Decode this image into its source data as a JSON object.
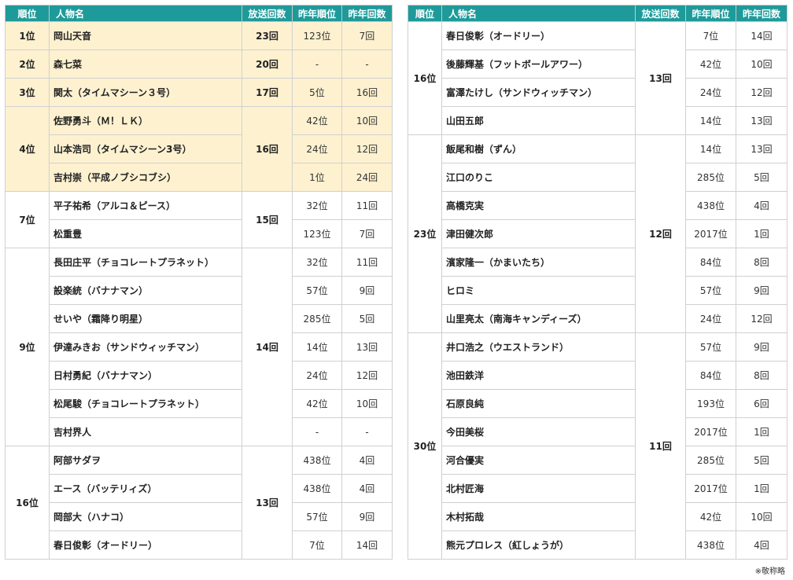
{
  "headers": {
    "rank": "順位",
    "name": "人物名",
    "count": "放送回数",
    "prev_rank": "昨年順位",
    "prev_count": "昨年回数"
  },
  "left_groups": [
    {
      "rank": "1位",
      "count": "23回",
      "highlight": true,
      "people": [
        {
          "name": "岡山天音",
          "prev_rank": "123位",
          "prev_count": "7回"
        }
      ]
    },
    {
      "rank": "2位",
      "count": "20回",
      "highlight": true,
      "people": [
        {
          "name": "森七菜",
          "prev_rank": "-",
          "prev_count": "-"
        }
      ]
    },
    {
      "rank": "3位",
      "count": "17回",
      "highlight": true,
      "people": [
        {
          "name": "関太（タイムマシーン３号）",
          "prev_rank": "5位",
          "prev_count": "16回"
        }
      ]
    },
    {
      "rank": "4位",
      "count": "16回",
      "highlight": true,
      "people": [
        {
          "name": "佐野勇斗（Ｍ！ＬＫ）",
          "prev_rank": "42位",
          "prev_count": "10回"
        },
        {
          "name": "山本浩司（タイムマシーン3号）",
          "prev_rank": "24位",
          "prev_count": "12回"
        },
        {
          "name": "吉村崇（平成ノブシコブシ）",
          "prev_rank": "1位",
          "prev_count": "24回"
        }
      ]
    },
    {
      "rank": "7位",
      "count": "15回",
      "highlight": false,
      "people": [
        {
          "name": "平子祐希（アルコ＆ピース）",
          "prev_rank": "32位",
          "prev_count": "11回"
        },
        {
          "name": "松重豊",
          "prev_rank": "123位",
          "prev_count": "7回"
        }
      ]
    },
    {
      "rank": "9位",
      "count": "14回",
      "highlight": false,
      "people": [
        {
          "name": "長田庄平（チョコレートプラネット）",
          "prev_rank": "32位",
          "prev_count": "11回"
        },
        {
          "name": "設楽統（バナナマン）",
          "prev_rank": "57位",
          "prev_count": "9回"
        },
        {
          "name": "せいや（霜降り明星）",
          "prev_rank": "285位",
          "prev_count": "5回"
        },
        {
          "name": "伊達みきお（サンドウィッチマン）",
          "prev_rank": "14位",
          "prev_count": "13回"
        },
        {
          "name": "日村勇紀（バナナマン）",
          "prev_rank": "24位",
          "prev_count": "12回"
        },
        {
          "name": "松尾駿（チョコレートプラネット）",
          "prev_rank": "42位",
          "prev_count": "10回"
        },
        {
          "name": "吉村界人",
          "prev_rank": "-",
          "prev_count": "-"
        }
      ]
    },
    {
      "rank": "16位",
      "count": "13回",
      "highlight": false,
      "people": [
        {
          "name": "阿部サダヲ",
          "prev_rank": "438位",
          "prev_count": "4回"
        },
        {
          "name": "エース（バッテリィズ）",
          "prev_rank": "438位",
          "prev_count": "4回"
        },
        {
          "name": "岡部大（ハナコ）",
          "prev_rank": "57位",
          "prev_count": "9回"
        },
        {
          "name": "春日俊彰（オードリー）",
          "prev_rank": "7位",
          "prev_count": "14回"
        }
      ]
    }
  ],
  "right_groups": [
    {
      "rank": "16位",
      "count": "13回",
      "highlight": false,
      "people": [
        {
          "name": "春日俊彰（オードリー）",
          "prev_rank": "7位",
          "prev_count": "14回"
        },
        {
          "name": "後藤輝基（フットボールアワー）",
          "prev_rank": "42位",
          "prev_count": "10回"
        },
        {
          "name": "富澤たけし（サンドウィッチマン）",
          "prev_rank": "24位",
          "prev_count": "12回"
        },
        {
          "name": "山田五郎",
          "prev_rank": "14位",
          "prev_count": "13回"
        }
      ]
    },
    {
      "rank": "23位",
      "count": "12回",
      "highlight": false,
      "people": [
        {
          "name": "飯尾和樹（ずん）",
          "prev_rank": "14位",
          "prev_count": "13回"
        },
        {
          "name": "江口のりこ",
          "prev_rank": "285位",
          "prev_count": "5回"
        },
        {
          "name": "高橋克実",
          "prev_rank": "438位",
          "prev_count": "4回"
        },
        {
          "name": "津田健次郎",
          "prev_rank": "2017位",
          "prev_count": "1回"
        },
        {
          "name": "濱家隆一（かまいたち）",
          "prev_rank": "84位",
          "prev_count": "8回"
        },
        {
          "name": "ヒロミ",
          "prev_rank": "57位",
          "prev_count": "9回"
        },
        {
          "name": "山里亮太（南海キャンディーズ）",
          "prev_rank": "24位",
          "prev_count": "12回"
        }
      ]
    },
    {
      "rank": "30位",
      "count": "11回",
      "highlight": false,
      "people": [
        {
          "name": "井口浩之（ウエストランド）",
          "prev_rank": "57位",
          "prev_count": "9回"
        },
        {
          "name": "池田鉄洋",
          "prev_rank": "84位",
          "prev_count": "8回"
        },
        {
          "name": "石原良純",
          "prev_rank": "193位",
          "prev_count": "6回"
        },
        {
          "name": "今田美桜",
          "prev_rank": "2017位",
          "prev_count": "1回"
        },
        {
          "name": "河合優実",
          "prev_rank": "285位",
          "prev_count": "5回"
        },
        {
          "name": "北村匠海",
          "prev_rank": "2017位",
          "prev_count": "1回"
        },
        {
          "name": "木村拓哉",
          "prev_rank": "42位",
          "prev_count": "10回"
        },
        {
          "name": "熊元プロレス（紅しょうが）",
          "prev_rank": "438位",
          "prev_count": "4回"
        }
      ]
    }
  ],
  "note": "※敬称略",
  "colors": {
    "header_bg": "#1f9a9a",
    "highlight_bg": "#fdf1d0",
    "border": "#d0d0d0"
  }
}
